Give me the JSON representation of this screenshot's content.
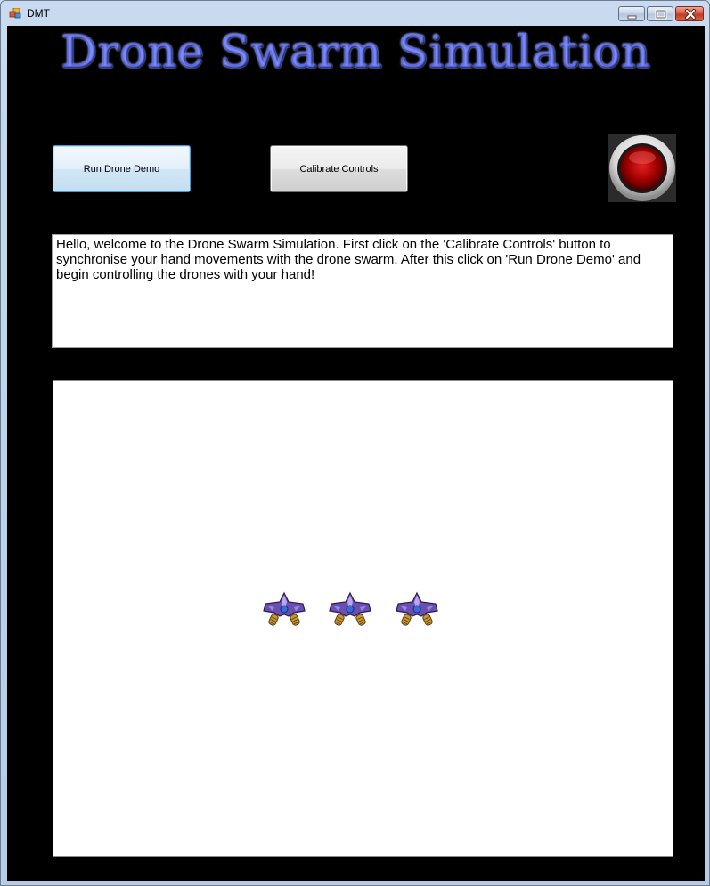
{
  "window": {
    "title": "DMT",
    "controls": {
      "minimize_icon": "minimize-icon",
      "maximize_icon": "maximize-icon",
      "close_icon": "close-icon"
    }
  },
  "header": {
    "title": "Drone Swarm Simulation"
  },
  "toolbar": {
    "run_label": "Run Drone Demo",
    "calibrate_label": "Calibrate Controls",
    "record_icon": "record-button-icon"
  },
  "info": {
    "text": "Hello, welcome to the Drone Swarm Simulation. First click on the 'Calibrate Controls' button to synchronise your hand movements with the drone swarm. After this click on 'Run Drone Demo' and begin controlling the drones with your hand!"
  },
  "simulation": {
    "drone_count": 3,
    "drone_icon": "drone-sprite-icon"
  },
  "colors": {
    "background": "#000000",
    "heading": "#1a2bd8",
    "record_red": "#c00000",
    "drone_purple": "#6a4fb3",
    "drone_gold": "#c89a2a"
  }
}
